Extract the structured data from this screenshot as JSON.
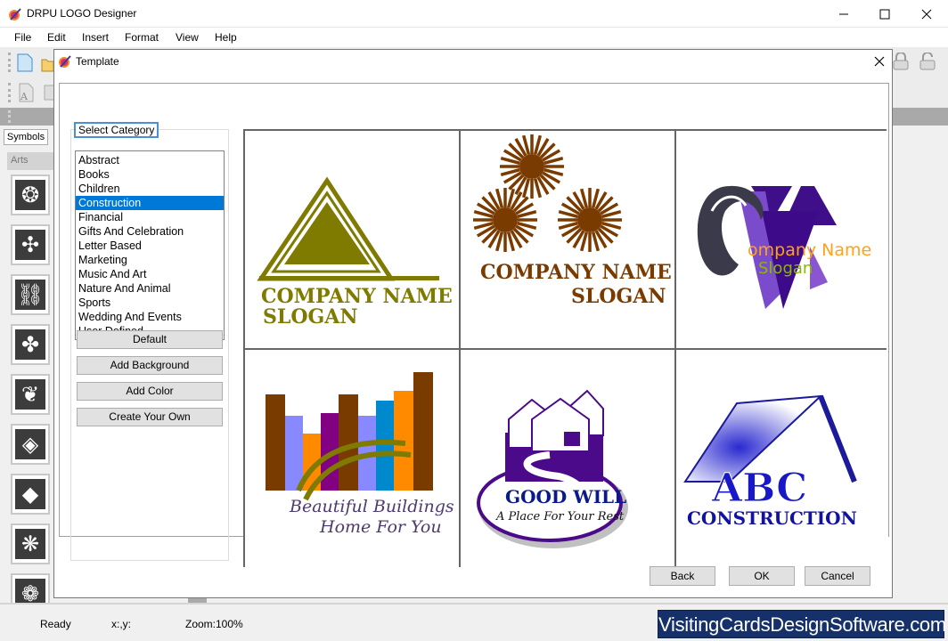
{
  "window": {
    "title": "DRPU LOGO Designer",
    "controls": {
      "minimize": "minimize",
      "maximize": "maximize",
      "close": "close"
    }
  },
  "menu": [
    "File",
    "Edit",
    "Insert",
    "Format",
    "View",
    "Help"
  ],
  "left_panel": {
    "tab_label": "Symbols",
    "section_label": "Arts",
    "symbol_count": 9
  },
  "dialog": {
    "title": "Template",
    "category_label": "Select Category",
    "categories": [
      "Abstract",
      "Books",
      "Children",
      "Construction",
      "Financial",
      "Gifts And Celebration",
      "Letter Based",
      "Marketing",
      "Music And Art",
      "Nature And Animal",
      "Sports",
      "Wedding And Events",
      "User Defined"
    ],
    "selected_category": "Construction",
    "side_buttons": [
      "Default",
      "Add Background",
      "Add Color",
      "Create Your Own"
    ],
    "templates": [
      {
        "name": "olive-triangle",
        "line1": "COMPANY NAME",
        "line2": "SLOGAN",
        "color": "#7f7a00"
      },
      {
        "name": "brown-suns",
        "line1": "COMPANY NAME",
        "line2": "SLOGAN",
        "color": "#7a3b00"
      },
      {
        "name": "purple-cv",
        "line1": "ompany Name",
        "line2": "Slogan",
        "color": "#ffa21a",
        "color2": "#88b800"
      },
      {
        "name": "bars-arc",
        "line1": "Beautiful Buildings",
        "line2": "Home For You",
        "color": "#4e3a6e"
      },
      {
        "name": "good-will",
        "line1": "GOOD WILL",
        "line2": "A Place For Your Rest",
        "color": "#0a1a8a"
      },
      {
        "name": "abc-construction",
        "line1": "ABC",
        "line2": "CONSTRUCTION",
        "color": "#1818c8"
      }
    ],
    "footer_buttons": {
      "back": "Back",
      "ok": "OK",
      "cancel": "Cancel"
    }
  },
  "status": {
    "state": "Ready",
    "coords": "x:,y:",
    "zoom": "Zoom:100%"
  },
  "brand": "VisitingCardsDesignSoftware.com"
}
